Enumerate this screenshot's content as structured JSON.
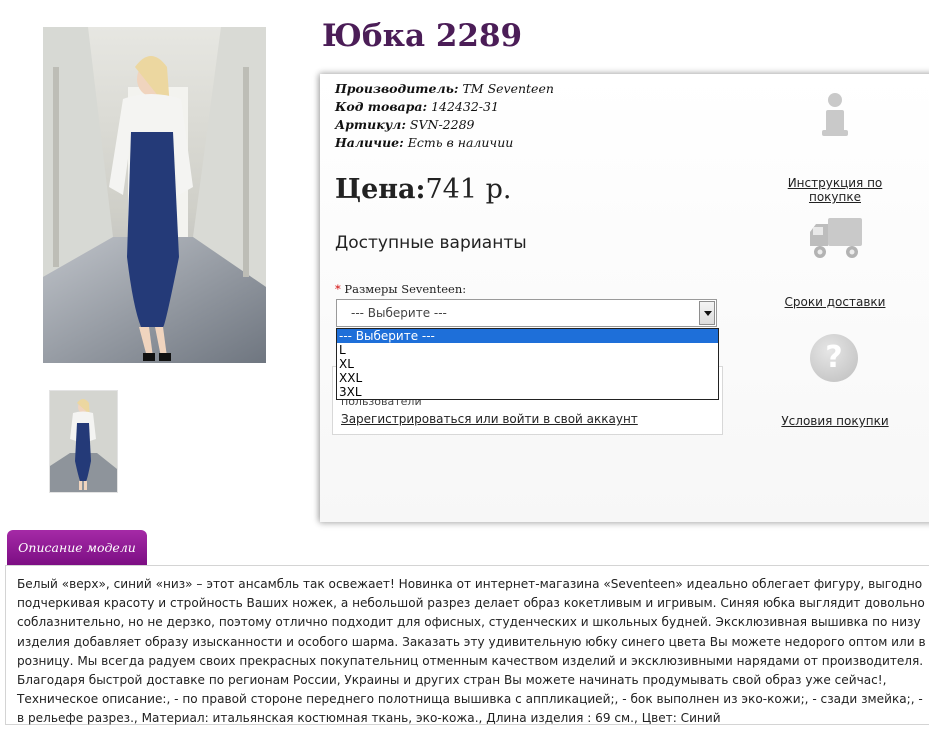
{
  "product": {
    "title": "Юбка 2289",
    "manufacturer_label": "Производитель:",
    "manufacturer_value": "ТМ Seventeen",
    "code_label": "Код товара:",
    "code_value": "142432-31",
    "sku_label": "Артикул:",
    "sku_value": "SVN-2289",
    "availability_label": "Наличие:",
    "availability_value": "Есть в наличии",
    "price_label": "Цена:",
    "price_value": "741 р."
  },
  "options": {
    "title": "Доступные варианты",
    "required_mark": "*",
    "size_label": "Размеры Seventeen:",
    "select_value": "--- Выберите ---",
    "dropdown_options": [
      "--- Выберите ---",
      "L",
      "XL",
      "XXL",
      "3XL"
    ]
  },
  "login_box": {
    "text": "пользователи",
    "link": "Зарегистрироваться или войти в свой аккаунт"
  },
  "side_links": {
    "instructions": "Инструкция по покупке",
    "delivery": "Сроки доставки",
    "terms": "Условия покупки"
  },
  "tabs": {
    "description": "Описание модели"
  },
  "description": "Белый «верх», синий «низ» – этот ансамбль так освежает! Новинка от интернет-магазина «Seventeen» идеально облегает фигуру, выгодно подчеркивая красоту и стройность Ваших ножек, а небольшой разрез делает образ кокетливым и игривым. Синяя юбка выглядит довольно соблазнительно, но не дерзко, поэтому отлично подходит для офисных, студенческих и школьных будней. Эксклюзивная вышивка по низу изделия добавляет образу изысканности и особого шарма. Заказать эту удивительную юбку синего цвета Вы можете недорого оптом или в розницу. Мы всегда радуем своих прекрасных покупательниц отменным качеством изделий и эксклюзивными нарядами от производителя. Благодаря быстрой доставке по регионам России, Украины и других стран Вы можете начинать продумывать свой образ уже сейчас!, Техническое описание:, - по правой стороне переднего полотнища вышивка с аппликацией;, - бок выполнен из эко-кожи;, - сзади змейка;, - в рельефе разрез., Материал: итальянская костюмная ткань, эко-кожа., Длина изделия : 69 см., Цвет: Синий",
  "colors": {
    "title": "#4b1d57",
    "tab": "#8e1a94",
    "dropdown_selected": "#1e6fd9",
    "icon_gray": "#c9c9c9"
  },
  "icons": [
    "info-icon",
    "truck-icon",
    "help-icon"
  ]
}
